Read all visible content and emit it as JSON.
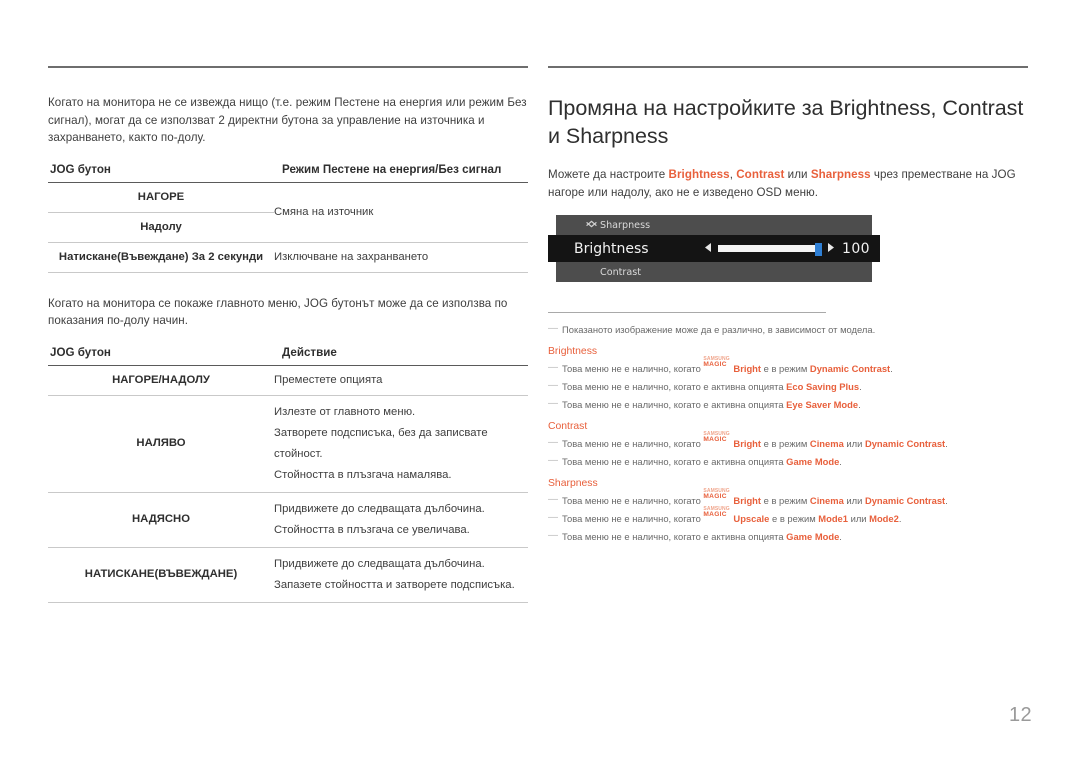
{
  "page": {
    "number": "12"
  },
  "left": {
    "intro_paragraph": "Когато на монитора не се извежда нищо (т.е. режим Пестене на енергия или режим Без сигнал), могат да се използват 2 директни бутона за управление на източника и захранването, както по-долу.",
    "table1": {
      "headers": [
        "JOG бутон",
        "Режим Пестене на енергия/Без сигнал"
      ],
      "rows": [
        {
          "button": "НАГОРЕ",
          "action": "Смяна на източник"
        },
        {
          "button": "Надолу",
          "action": ""
        },
        {
          "button": "Натискане(Въвеждане) За 2 секунди",
          "action": "Изключване на захранването"
        }
      ]
    },
    "second_paragraph": "Когато на монитора се покаже главното меню, JOG бутонът може да се използва по показания по-долу начин.",
    "table2": {
      "headers": [
        "JOG бутон",
        "Действие"
      ],
      "rows": [
        {
          "button": "НАГОРЕ/НАДОЛУ",
          "actions": [
            "Преместете опцията"
          ]
        },
        {
          "button": "НАЛЯВО",
          "actions": [
            "Излезте от главното меню.",
            "Затворете подсписъка, без да записвате стойност.",
            "Стойността в плъзгача намалява."
          ]
        },
        {
          "button": "НАДЯСНО",
          "actions": [
            "Придвижете до следващата дълбочина.",
            "Стойността в плъзгача се увеличава."
          ]
        },
        {
          "button": "НАТИСКАНЕ(ВЪВЕЖДАНЕ)",
          "actions": [
            "Придвижете до следващата дълбочина.",
            "Запазете стойността и затворете подсписъка."
          ]
        }
      ]
    }
  },
  "right": {
    "title": "Промяна на настройките за Brightness, Contrast и Sharpness",
    "intro": {
      "part1": "Можете да настроите ",
      "hl1": "Brightness",
      "sep1": ", ",
      "hl2": "Contrast",
      "sep2": " или ",
      "hl3": "Sharpness",
      "part2": " чрез преместване на JOG нагоре или надолу, ако не е изведено OSD меню."
    },
    "osd": {
      "top_item": "Sharpness",
      "top_chevron": "chevron-up-icon",
      "active_item": "Brightness",
      "value": "100",
      "bottom_item": "Contrast",
      "bottom_chevron": "chevron-down-icon",
      "left_arrow": "◄",
      "right_arrow": "►",
      "slider_fill_percent": 100,
      "thumb_color": "#2f7fd4",
      "panel_color": "#4d4d4d",
      "active_row_color": "#141414"
    },
    "notes": {
      "general": "Показаното изображение може да е различно, в зависимост от модела.",
      "sections": [
        {
          "heading": "Brightness",
          "items": [
            {
              "pre": "Това меню не е налично, когато ",
              "logo": true,
              "logo_line1": "SAMSUNG",
              "logo_line2": "MAGIC",
              "bold1": "Bright",
              "mid": " е в режим ",
              "bold2": "Dynamic Contrast",
              "post": "."
            },
            {
              "pre": "Това меню не е налично, когато е активна опцията ",
              "logo": false,
              "bold2": "Eco Saving Plus",
              "post": "."
            },
            {
              "pre": "Това меню не е налично, когато е активна опцията ",
              "logo": false,
              "bold2": "Eye Saver Mode",
              "post": "."
            }
          ]
        },
        {
          "heading": "Contrast",
          "items": [
            {
              "pre": "Това меню не е налично, когато ",
              "logo": true,
              "logo_line1": "SAMSUNG",
              "logo_line2": "MAGIC",
              "bold1": "Bright",
              "mid": " е в режим ",
              "bold2": "Cinema",
              "mid2": " или ",
              "bold3": "Dynamic Contrast",
              "post": "."
            },
            {
              "pre": "Това меню не е налично, когато е активна опцията ",
              "logo": false,
              "bold2": "Game Mode",
              "post": "."
            }
          ]
        },
        {
          "heading": "Sharpness",
          "items": [
            {
              "pre": "Това меню не е налично, когато ",
              "logo": true,
              "logo_line1": "SAMSUNG",
              "logo_line2": "MAGIC",
              "bold1": "Bright",
              "mid": " е в режим ",
              "bold2": "Cinema",
              "mid2": " или ",
              "bold3": "Dynamic Contrast",
              "post": "."
            },
            {
              "pre": "Това меню не е налично, когато ",
              "logo": true,
              "logo_line1": "SAMSUNG",
              "logo_line2": "MAGIC",
              "bold1": "Upscale",
              "mid": " е в режим ",
              "bold2": "Mode1",
              "mid2": " или ",
              "bold3": "Mode2",
              "post": "."
            },
            {
              "pre": "Това меню не е налично, когато е активна опцията ",
              "logo": false,
              "bold2": "Game Mode",
              "post": "."
            }
          ]
        }
      ]
    }
  },
  "colors": {
    "accent": "#e8603c",
    "text": "#3e3e3e",
    "muted": "#6a6a6a"
  }
}
